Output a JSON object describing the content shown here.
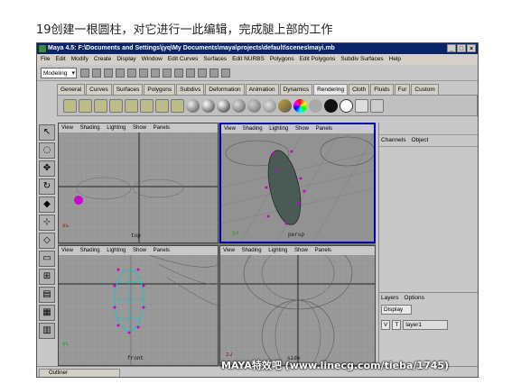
{
  "caption": "19创建一根圆柱，对它进行一此编辑，完成腿上部的工作",
  "window": {
    "title": "Maya 4.5: F:\\Documents and Settings\\jyq\\My Documents\\maya\\projects\\default\\scenes\\mayi.mb",
    "buttons": [
      "_",
      "□",
      "×"
    ]
  },
  "menubar": [
    "File",
    "Edit",
    "Modify",
    "Create",
    "Display",
    "Window",
    "Edit Curves",
    "Surfaces",
    "Edit NURBS",
    "Polygons",
    "Edit Polygons",
    "Subdiv Surfaces",
    "Help"
  ],
  "status_line": {
    "mode": "Modeling"
  },
  "shelf_tabs": [
    "General",
    "Curves",
    "Surfaces",
    "Polygons",
    "Subdivs",
    "Deformation",
    "Animation",
    "Dynamics",
    "Rendering",
    "Cloth",
    "Fluids",
    "Fur",
    "Custom"
  ],
  "active_shelf_tab": "Rendering",
  "viewport_menu": [
    "View",
    "Shading",
    "Lighting",
    "Show",
    "Panels"
  ],
  "viewports": [
    {
      "label": "top",
      "active": false
    },
    {
      "label": "persp",
      "active": true
    },
    {
      "label": "front",
      "active": false
    },
    {
      "label": "side",
      "active": false
    }
  ],
  "channel_box": {
    "menu": [
      "Channels",
      "Object"
    ]
  },
  "layers": {
    "menu": [
      "Layers",
      "Options"
    ],
    "display": "Display",
    "row": {
      "v": "V",
      "t": "T",
      "name": "layer1"
    }
  },
  "outliner": {
    "label": "Outliner"
  },
  "watermark": "MAYA特效吧 (www.linecg.com/tieba/1745)",
  "colors": {
    "title_bar": "#0a246a",
    "ui_grey": "#c8c8c8",
    "viewport_grey": "#9a9a9a",
    "selection_magenta": "#cc00cc",
    "active_border": "#0000aa"
  }
}
